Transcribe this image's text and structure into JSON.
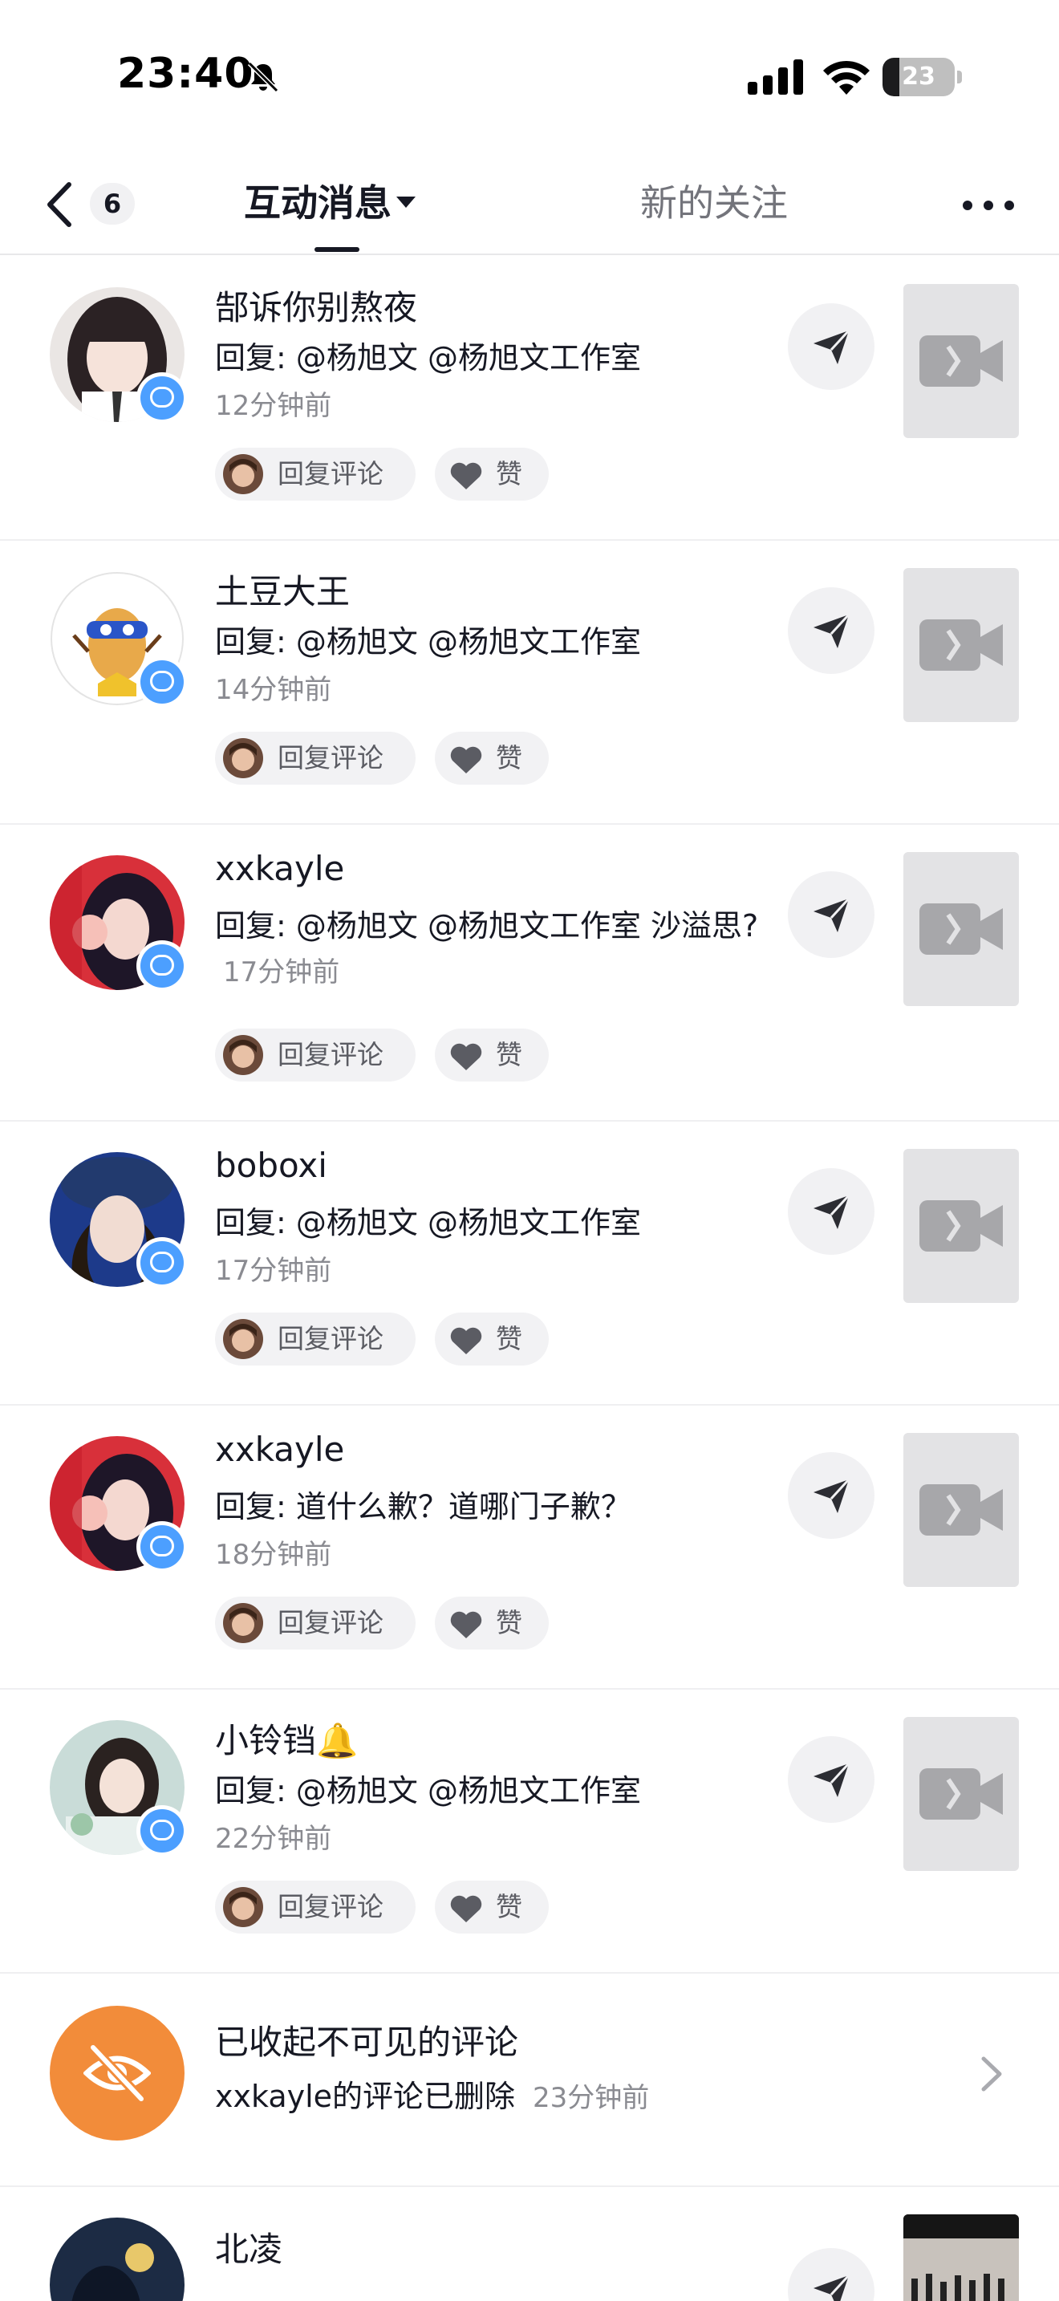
{
  "status_bar": {
    "time": "23:40",
    "battery_level": "23",
    "battery_fraction": 0.23
  },
  "header": {
    "back_count": "6",
    "tab_active": "互动消息",
    "tab_inactive": "新的关注"
  },
  "actions": {
    "reply_comment": "回复评论",
    "like": "赞"
  },
  "notifications": [
    {
      "name": "郜诉你别熬夜",
      "reply": "回复: @杨旭文 @杨旭文工作室",
      "time": "12分钟前"
    },
    {
      "name": "土豆大王",
      "reply": "回复: @杨旭文 @杨旭文工作室",
      "time": "14分钟前"
    },
    {
      "name": "xxkayle",
      "reply": "回复: @杨旭文 @杨旭文工作室 沙溢思?",
      "time": "17分钟前"
    },
    {
      "name": "boboxi",
      "reply": "回复: @杨旭文 @杨旭文工作室",
      "time": "17分钟前"
    },
    {
      "name": "xxkayle",
      "reply": "回复: 道什么歉？道哪门子歉？",
      "time": "18分钟前"
    },
    {
      "name": "小铃铛🔔",
      "reply": "回复: @杨旭文 @杨旭文工作室",
      "time": "22分钟前"
    }
  ],
  "collapsed": {
    "title": "已收起不可见的评论",
    "subtitle": "xxkayle的评论已删除",
    "time": "23分钟前"
  },
  "last_item": {
    "name": "北凌"
  },
  "colors": {
    "badge_blue": "#4c9fff",
    "hidden_orange": "#f28c3a",
    "text_primary": "#161823",
    "text_secondary": "#8a8b91"
  }
}
